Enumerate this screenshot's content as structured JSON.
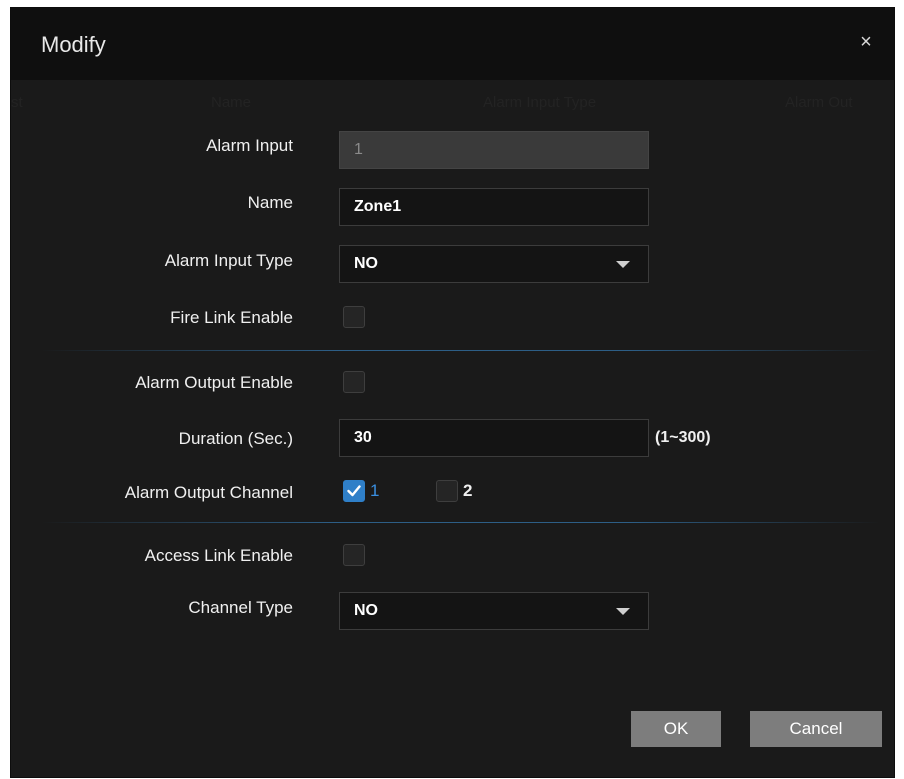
{
  "dialog": {
    "title": "Modify",
    "close_glyph": "×"
  },
  "background_header": {
    "col1": "st",
    "col2": "Name",
    "col3": "Alarm Input Type",
    "col4": "Alarm Out"
  },
  "form": {
    "alarm_input": {
      "label": "Alarm Input",
      "value": "1"
    },
    "name": {
      "label": "Name",
      "value": "Zone1"
    },
    "alarm_input_type": {
      "label": "Alarm Input Type",
      "selected": "NO"
    },
    "fire_link_enable": {
      "label": "Fire Link Enable",
      "checked": false
    },
    "alarm_output_enable": {
      "label": "Alarm Output Enable",
      "checked": false
    },
    "duration": {
      "label": "Duration (Sec.)",
      "value": "30",
      "range": "(1~300)"
    },
    "alarm_output_channel": {
      "label": "Alarm Output Channel",
      "channels": [
        {
          "label": "1",
          "checked": true
        },
        {
          "label": "2",
          "checked": false
        }
      ]
    },
    "access_link_enable": {
      "label": "Access Link Enable",
      "checked": false
    },
    "channel_type": {
      "label": "Channel Type",
      "selected": "NO"
    }
  },
  "buttons": {
    "ok": "OK",
    "cancel": "Cancel"
  },
  "icons": {
    "close": "close-icon",
    "dropdown": "chevron-down-icon",
    "check": "checkmark-icon"
  },
  "colors": {
    "dialog_bg": "#1a1a1a",
    "titlebar_bg": "#0f0f0f",
    "accent": "#2f7fc8",
    "button_bg": "#7d7d7d"
  }
}
